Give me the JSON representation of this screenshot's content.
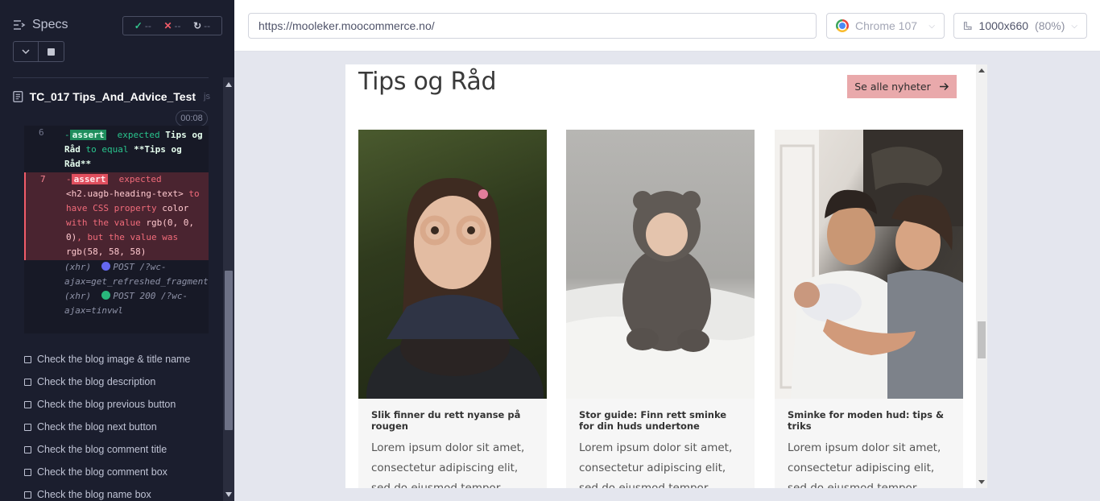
{
  "runner": {
    "specs_label": "Specs",
    "passed": "--",
    "failed": "--",
    "pending": "--",
    "test_title": "TC_017 Tips_And_Advice_Test",
    "test_file_suffix": "js",
    "timer": "00:08",
    "commands": [
      {
        "num": "6",
        "state": "pass",
        "prefix": "-",
        "tag": "assert",
        "parts": [
          "expected",
          "Tips og Råd",
          "to equal",
          "**Tips og Råd**"
        ]
      },
      {
        "num": "7",
        "state": "fail",
        "prefix": "-",
        "tag": "assert",
        "parts": [
          "expected",
          "<h2.uagb-heading-text>",
          "to have CSS property",
          "color",
          "with the value",
          "rgb(0, 0, 0)",
          ", but the value was",
          "rgb(58, 58, 58)"
        ]
      }
    ],
    "xhr": [
      {
        "label": "(xhr)",
        "text": "POST /?wc-ajax=get_refreshed_fragments",
        "dot": "#6468f1"
      },
      {
        "label": "(xhr)",
        "text": "POST 200 /?wc-ajax=tinvwl",
        "dot": "#29b77c"
      }
    ],
    "tests": [
      "Check the blog image & title name",
      "Check the blog description",
      "Check the blog previous button",
      "Check the blog next button",
      "Check the blog comment title",
      "Check the blog comment box",
      "Check the blog name box"
    ]
  },
  "autbar": {
    "url": "https://mooleker.moocommerce.no/",
    "browser": "Chrome 107",
    "viewport": "1000x660",
    "scale": "(80%)"
  },
  "page": {
    "heading": "Tips og Råd",
    "news_button": "Se alle nyheter",
    "cards": [
      {
        "title": "Slik finner du rett nyanse på rougen",
        "desc": "Lorem ipsum dolor sit amet, consectetur adipiscing elit, sed do eiusmod tempor incididunt ut"
      },
      {
        "title": "Stor guide: Finn rett sminke for din huds undertone",
        "desc": "Lorem ipsum dolor sit amet, consectetur adipiscing elit, sed do eiusmod tempor incididunt ut"
      },
      {
        "title": "Sminke for moden hud: tips & triks",
        "desc": "Lorem ipsum dolor sit amet, consectetur adipiscing elit, sed do eiusmod tempor incididunt ut"
      }
    ]
  },
  "colors": {
    "runner_bg": "#1b1e2e",
    "pass": "#29c48d",
    "fail": "#f15c69",
    "button_pink": "#e9a9ab"
  }
}
